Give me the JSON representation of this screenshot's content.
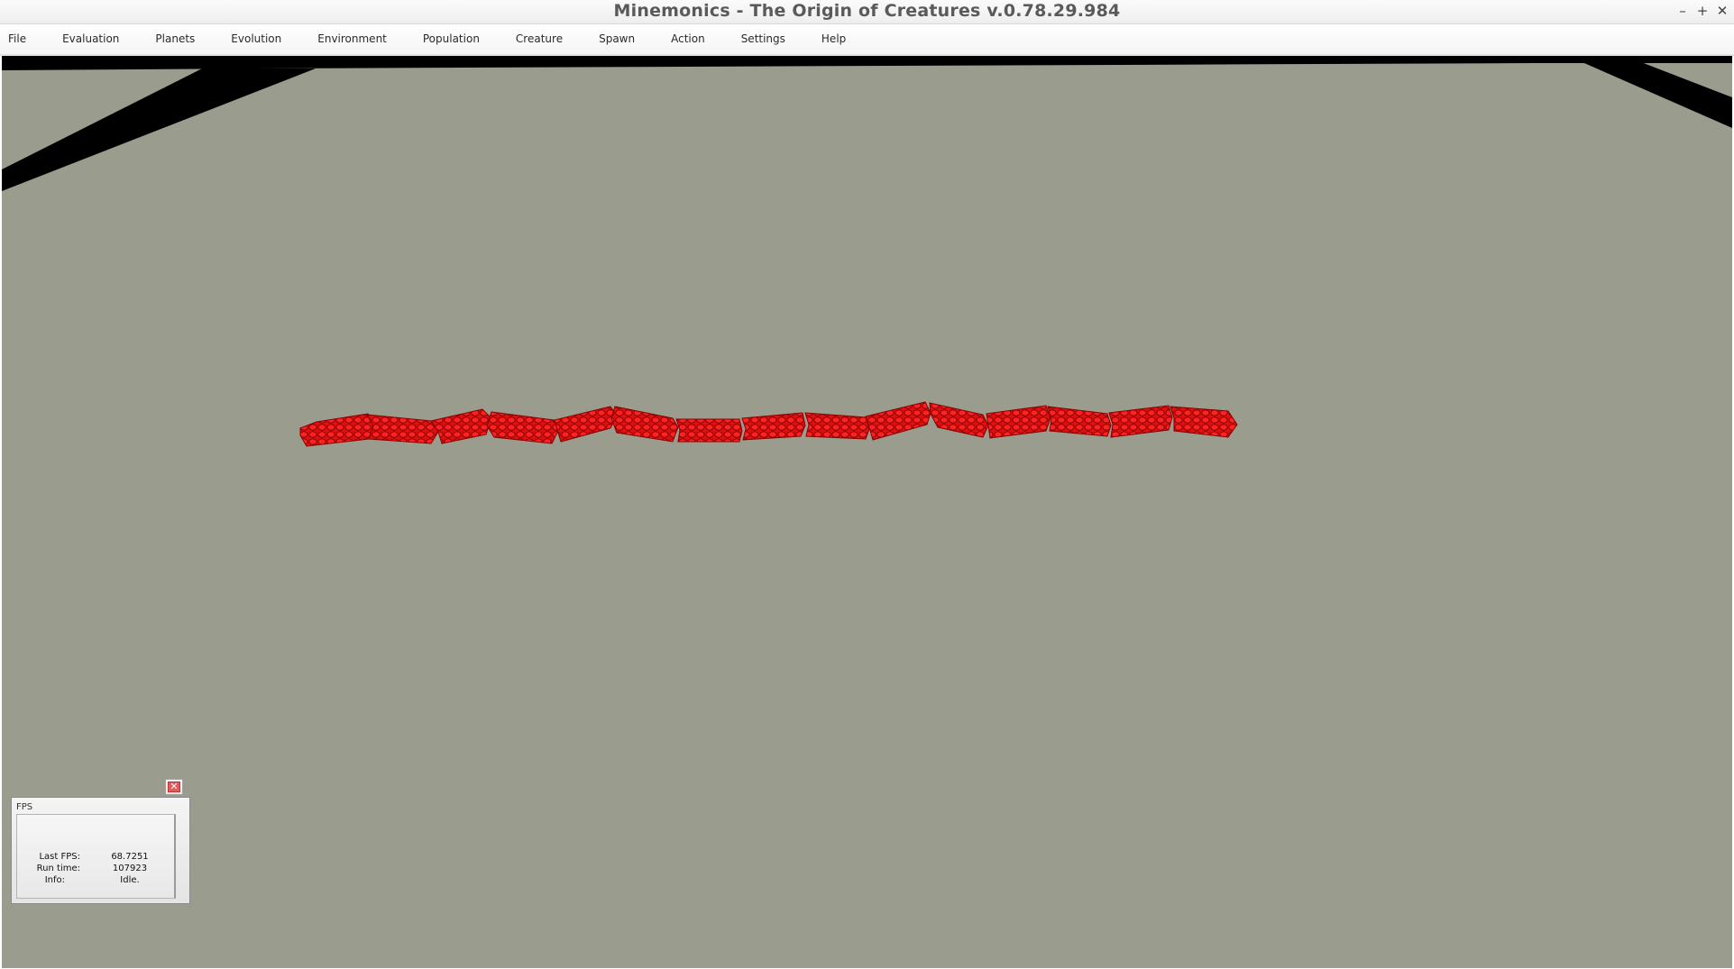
{
  "window": {
    "title": "Minemonics - The Origin of Creatures v.0.78.29.984",
    "controls": [
      {
        "name": "minimize-icon",
        "glyph": "–"
      },
      {
        "name": "maximize-icon",
        "glyph": "+"
      },
      {
        "name": "close-icon",
        "glyph": "✕"
      }
    ]
  },
  "menu": [
    "File",
    "Evaluation",
    "Planets",
    "Evolution",
    "Environment",
    "Population",
    "Creature",
    "Spawn",
    "Action",
    "Settings",
    "Help"
  ],
  "scene": {
    "ground_color": "#9a9c8e",
    "edge_color": "#000000",
    "creature_color": "#e01010",
    "creature_segments": 15
  },
  "fps_panel": {
    "title": "FPS",
    "rows": [
      {
        "label": "Last FPS:",
        "value": "68.7251"
      },
      {
        "label": "Run time:",
        "value": "107923"
      },
      {
        "label": "Info:",
        "value": "Idle."
      }
    ],
    "close_glyph": "✕"
  }
}
